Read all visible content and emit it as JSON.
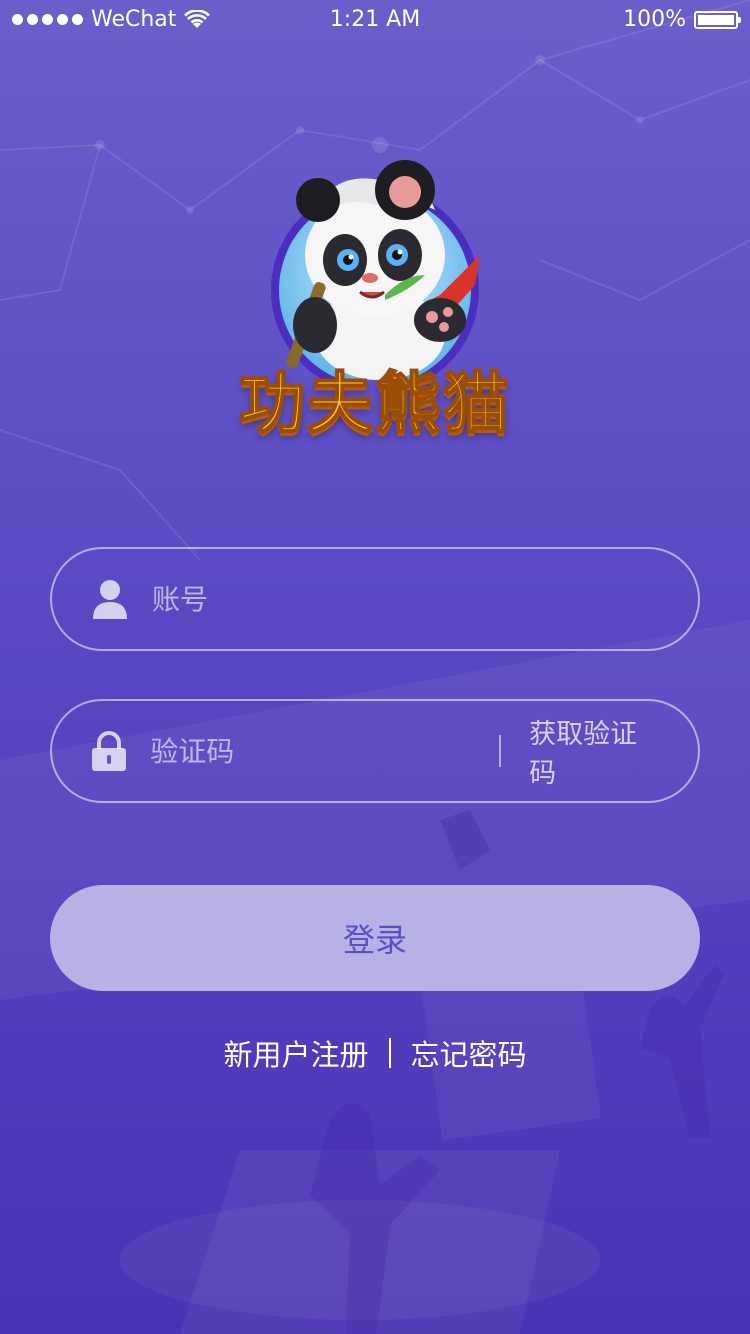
{
  "status_bar": {
    "carrier": "WeChat",
    "time": "1:21 AM",
    "battery": "100%"
  },
  "logo": {
    "title": "功夫熊猫"
  },
  "form": {
    "account_placeholder": "账号",
    "code_placeholder": "验证码",
    "get_code_label": "获取验证码",
    "login_label": "登录"
  },
  "links": {
    "register": "新用户注册",
    "forgot": "忘记密码"
  },
  "colors": {
    "bg_top": "#6a5fcb",
    "bg_bottom": "#4a33b4",
    "button_bg": "#b7b1e6",
    "button_text": "#5d4fc0",
    "logo_gold": "#ffd42a"
  }
}
